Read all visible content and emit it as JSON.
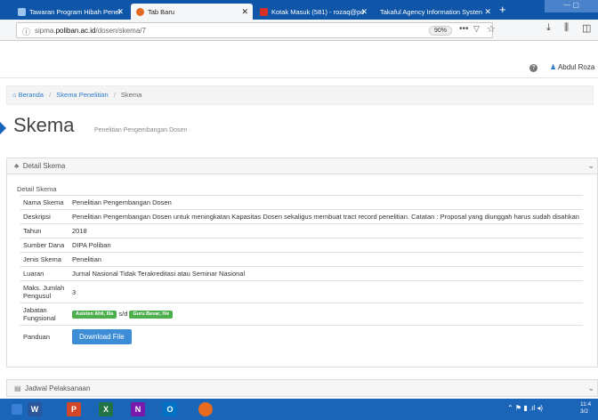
{
  "browser": {
    "tabs": [
      {
        "label": "Tawaran Program Hibah Penel",
        "active": false
      },
      {
        "label": "Tab Baru",
        "active": true
      },
      {
        "label": "Kotak Masuk (581) - rozaq@po",
        "active": false
      },
      {
        "label": "Takaful Agency Information Systen",
        "active": false
      }
    ],
    "new_tab": "+",
    "url_prefix": "sipma.",
    "url_domain": "poliban.ac.id",
    "url_path": "/dosen/skema/7",
    "zoom": "90%"
  },
  "userbar": {
    "user_name": "Abdul Roza"
  },
  "breadcrumb": {
    "home": "Beranda",
    "parent": "Skema Penelitian",
    "current": "Skema"
  },
  "page": {
    "title": "Skema",
    "subtitle": "Penelitian Pengembangan Dosen"
  },
  "panel": {
    "title": "Detail Skema",
    "section_label": "Detail Skema",
    "rows": [
      {
        "key": "Nama Skema",
        "value": "Penelitian Pengembangan Dosen"
      },
      {
        "key": "Deskripsi",
        "value": "Penelitian Pengembangan Dosen untuk meningkatan Kapasitas Dosen sekaligus membuat tract record penelitian. Catatan : Proposal yang diunggah harus sudah disahkan"
      },
      {
        "key": "Tahun",
        "value": "2018"
      },
      {
        "key": "Sumber Dana",
        "value": "DIPA Poliban"
      },
      {
        "key": "Jenis Skema",
        "value": "Penelitian"
      },
      {
        "key": "Luaran",
        "value": "Jurnal Nasional Tidak Terakreditasi atau Seminar Nasional"
      },
      {
        "key": "Maks. Jumlah Pengusul",
        "value": "3"
      }
    ],
    "jabatan": {
      "key": "Jabatan Fungsional",
      "from": "Asisten Ahli, IIIa",
      "sep": "s/d",
      "to": "Guru Besar, IVe"
    },
    "panduan": {
      "key": "Panduan",
      "button": "Download File"
    }
  },
  "panel2": {
    "title": "Jadwal Pelaksanaan"
  },
  "taskbar": {
    "clock_time": "11:4",
    "clock_date": "3/2"
  }
}
